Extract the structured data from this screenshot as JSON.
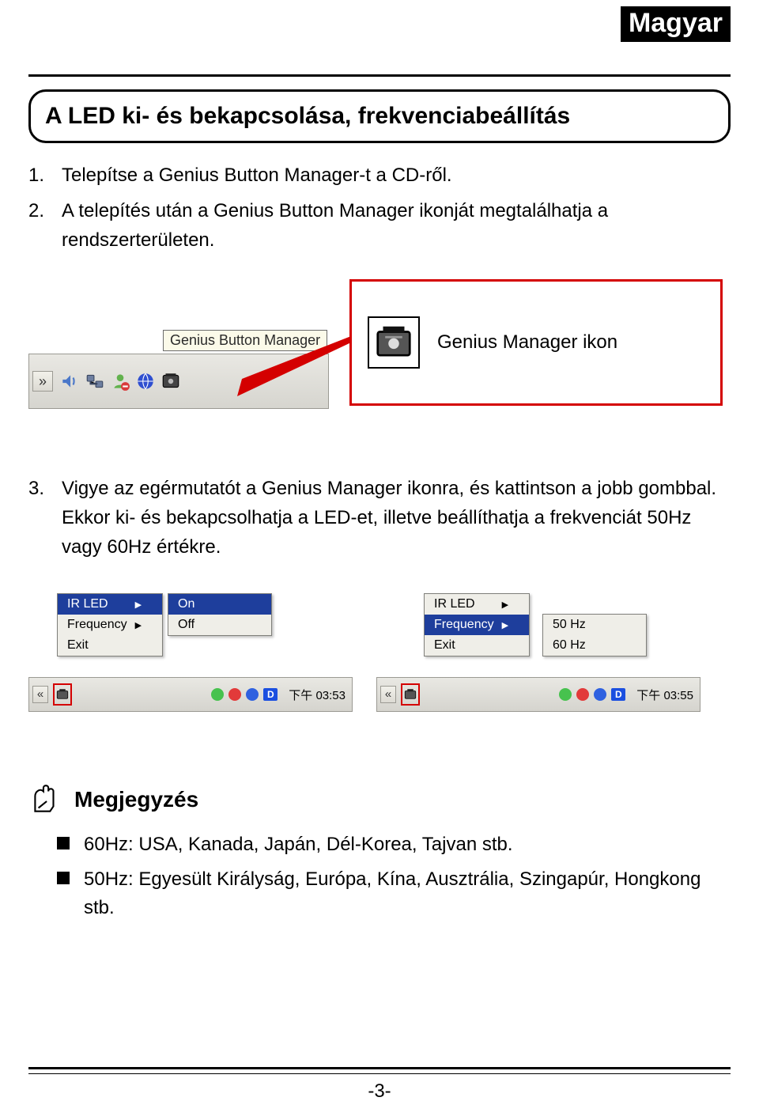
{
  "lang_badge": "Magyar",
  "section_title": "A LED ki- és bekapcsolása, frekvenciabeállítás",
  "steps": {
    "s1": {
      "num": "1.",
      "text": "Telepítse a Genius Button Manager-t a CD-ről."
    },
    "s2": {
      "num": "2.",
      "text": "A telepítés után a Genius Button Manager ikonját megtalálhatja a rendszerterületen."
    },
    "s3": {
      "num": "3.",
      "text": "Vigye az egérmutatót a Genius Manager ikonra, és kattintson a jobb gombbal. Ekkor ki- és bekapcsolhatja a LED-et, illetve beállíthatja a frekvenciát 50Hz vagy 60Hz értékre."
    }
  },
  "fig1": {
    "tooltip": "Genius Button Manager",
    "chevrons": "»",
    "callout_label": "Genius Manager ikon"
  },
  "fig2": {
    "chev": "«",
    "clock_a": "下午 03:53",
    "clock_b": "下午 03:55",
    "d_label": "D",
    "menuA1": {
      "r1": "IR LED",
      "r2": "Frequency",
      "r3": "Exit"
    },
    "menuA2": {
      "r1": "On",
      "r2": "Off"
    },
    "menuB1": {
      "r1": "IR LED",
      "r2": "Frequency",
      "r3": "Exit"
    },
    "menuB2": {
      "r1": "50 Hz",
      "r2": "60 Hz"
    }
  },
  "note": {
    "title": "Megjegyzés",
    "n1": "60Hz: USA, Kanada, Japán, Dél-Korea, Tajvan stb.",
    "n2": "50Hz: Egyesült Királyság, Európa, Kína, Ausztrália, Szingapúr, Hongkong stb."
  },
  "page_number": "-3-"
}
